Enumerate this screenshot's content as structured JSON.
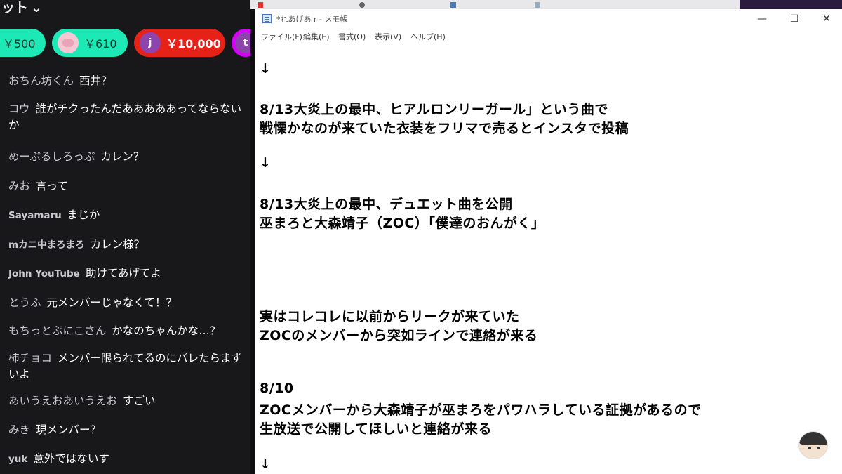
{
  "chat": {
    "header": "ット",
    "super_chats": [
      {
        "amount": "￥500"
      },
      {
        "amount": "￥610"
      },
      {
        "initial": "j",
        "amount": "￥10,000"
      },
      {
        "initial": "t"
      }
    ],
    "messages": [
      {
        "author": "おちん坊くん",
        "text": "西井？"
      },
      {
        "author": "コウ",
        "text": "誰がチクったんだあああああってならないか"
      },
      {
        "author": "めーぷるしろっぷ",
        "text": "カレン？"
      },
      {
        "author": "みお",
        "text": "言って"
      },
      {
        "author": "Sayamaru",
        "text": "まじか"
      },
      {
        "author": "mカニ中まろまろ",
        "text": "カレン様？"
      },
      {
        "author": "John YouTube",
        "text": "助けてあげてよ"
      },
      {
        "author": "とうふ",
        "text": "元メンバーじゃなくて！？"
      },
      {
        "author": "もちっとぷにこさん",
        "text": "かなのちゃんかな…？"
      },
      {
        "author": "柿チョコ",
        "text": "メンバー限られてるのにバレたらまずいよ"
      },
      {
        "author": "あいうえおあいうえお",
        "text": "すごい"
      },
      {
        "author": "みき",
        "text": "現メンバー？"
      },
      {
        "author": "yuk",
        "text": "意外ではないす"
      }
    ]
  },
  "notepad": {
    "title": "*れあげあ r - メモ帳",
    "menu": [
      "ファイル(F)",
      "編集(E)",
      "書式(O)",
      "表示(V)",
      "ヘルプ(H)"
    ],
    "lines": [
      "↓",
      "8/13大炎上の最中、ヒアルロンリーガール」という曲で",
      "戦慄かなのが来ていた衣装をフリマで売るとインスタで投稿",
      "↓",
      "8/13大炎上の最中、デュエット曲を公開",
      "巫まろと大森靖子（ZOC）「僕達のおんがく」",
      "実はコレコレに以前からリークが来ていた",
      "ZOCのメンバーから突如ラインで連絡が来る",
      "8/10",
      "ZOCメンバーから大森靖子が巫まろをパワハラしている証拠があるので",
      "生放送で公開してほしいと連絡が来る",
      "↓"
    ]
  },
  "window_buttons": {
    "minimize": "—",
    "maximize": "☐",
    "close": "✕"
  }
}
